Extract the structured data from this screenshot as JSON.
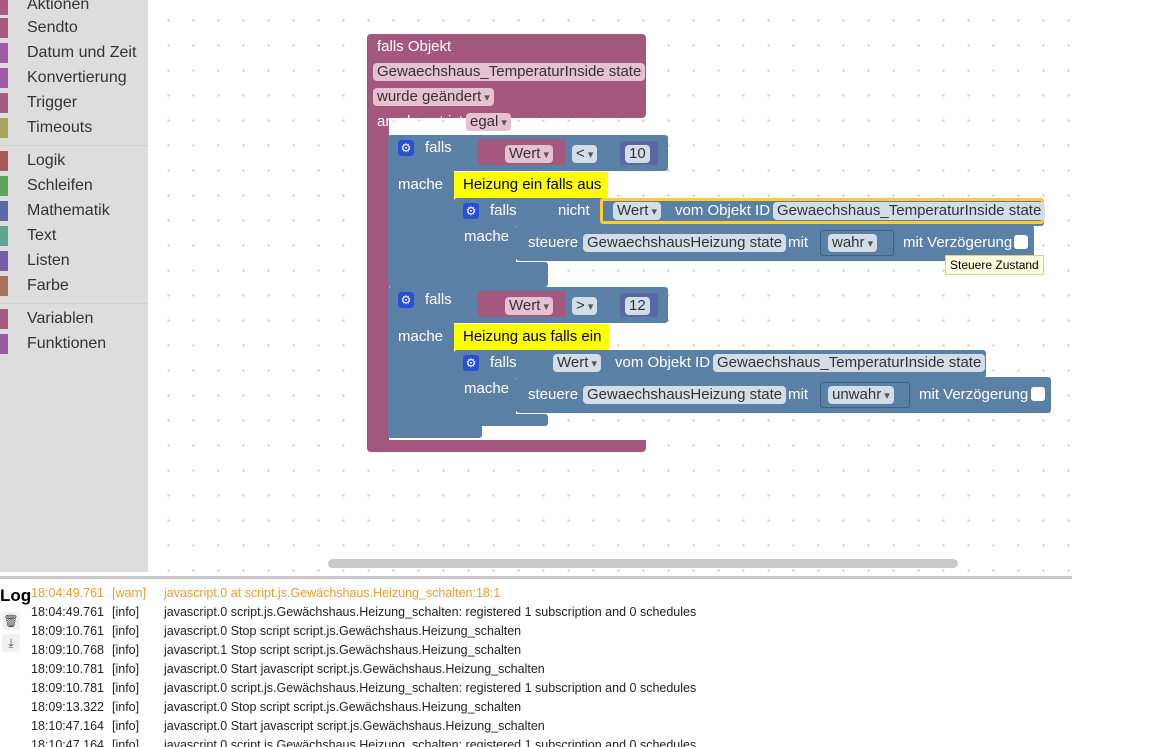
{
  "toolbox": {
    "categories": [
      {
        "label": "Aktionen",
        "color": "#a65c81"
      },
      {
        "label": "Sendto",
        "color": "#a65c81"
      },
      {
        "label": "Datum und Zeit",
        "color": "#9f5ca6"
      },
      {
        "label": "Konvertierung",
        "color": "#9f5ca6"
      },
      {
        "label": "Trigger",
        "color": "#a65c81"
      },
      {
        "label": "Timeouts",
        "color": "#a6a65c"
      },
      {
        "label": "Logik",
        "color": "#a65c5c"
      },
      {
        "label": "Schleifen",
        "color": "#5ca65c"
      },
      {
        "label": "Mathematik",
        "color": "#5c68a6"
      },
      {
        "label": "Text",
        "color": "#5ca68d"
      },
      {
        "label": "Listen",
        "color": "#745ca6"
      },
      {
        "label": "Farbe",
        "color": "#a6745c"
      },
      {
        "label": "Variablen",
        "color": "#a55b80"
      },
      {
        "label": "Funktionen",
        "color": "#995ba5"
      }
    ]
  },
  "blocks": {
    "trigger": {
      "title": "falls Objekt",
      "object": "Gewaechshaus_TemperaturInside state",
      "change": "wurde geändert",
      "ack_label": "anerkannt ist",
      "ack_value": "egal"
    },
    "if1": {
      "falls": "falls",
      "wert": "Wert",
      "op": "<",
      "num": "10",
      "mache": "mache",
      "comment": "Heizung ein falls aus",
      "inner_falls": "falls",
      "nicht": "nicht",
      "inner_wert": "Wert",
      "vom": "vom Objekt ID",
      "obj": "Gewaechshaus_TemperaturInside state",
      "inner_mache": "mache",
      "steuere": "steuere",
      "steuere_obj": "GewaechshausHeizung state",
      "mit": "mit",
      "value": "wahr",
      "delay": "mit Verzögerung"
    },
    "if2": {
      "falls": "falls",
      "wert": "Wert",
      "op": ">",
      "num": "12",
      "mache": "mache",
      "comment": "Heizung aus falls ein",
      "inner_falls": "falls",
      "inner_wert": "Wert",
      "vom": "vom Objekt ID",
      "obj": "Gewaechshaus_TemperaturInside state",
      "inner_mache": "mache",
      "steuere": "steuere",
      "steuere_obj": "GewaechshausHeizung state",
      "mit": "mit",
      "value": "unwahr",
      "delay": "mit Verzögerung"
    },
    "tooltip": "Steuere Zustand"
  },
  "log": {
    "title": "Log",
    "rows": [
      {
        "time": "18:04:49.761",
        "level": "[warn]",
        "msg": "javascript.0 at script.js.Gewächshaus.Heizung_schalten:18:1"
      },
      {
        "time": "18:04:49.761",
        "level": "[info]",
        "msg": "javascript.0 script.js.Gewächshaus.Heizung_schalten: registered 1 subscription and 0 schedules"
      },
      {
        "time": "18:09:10.761",
        "level": "[info]",
        "msg": "javascript.0 Stop script script.js.Gewächshaus.Heizung_schalten"
      },
      {
        "time": "18:09:10.768",
        "level": "[info]",
        "msg": "javascript.1 Stop script script.js.Gewächshaus.Heizung_schalten"
      },
      {
        "time": "18:09:10.781",
        "level": "[info]",
        "msg": "javascript.0 Start javascript script.js.Gewächshaus.Heizung_schalten"
      },
      {
        "time": "18:09:10.781",
        "level": "[info]",
        "msg": "javascript.0 script.js.Gewächshaus.Heizung_schalten: registered 1 subscription and 0 schedules"
      },
      {
        "time": "18:09:13.322",
        "level": "[info]",
        "msg": "javascript.0 Stop script script.js.Gewächshaus.Heizung_schalten"
      },
      {
        "time": "18:10:47.164",
        "level": "[info]",
        "msg": "javascript.0 Start javascript script.js.Gewächshaus.Heizung_schalten"
      },
      {
        "time": "18:10:47.164",
        "level": "[info]",
        "msg": "javascript.0 script.js.Gewächshaus.Heizung_schalten: registered 1 subscription and 0 schedules"
      }
    ]
  }
}
